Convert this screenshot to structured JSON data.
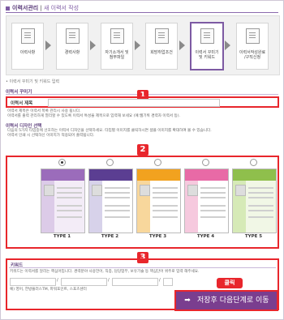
{
  "header": {
    "title": "이력서관리",
    "separator": " | ",
    "subtitle": "새 이력서 작성"
  },
  "steps": [
    {
      "label": "이력사항"
    },
    {
      "label": "경력사항"
    },
    {
      "label": "자기소개서 및\n첨부파일"
    },
    {
      "label": "희망취업조건"
    },
    {
      "label": "이력서 꾸미기\n및 키워드"
    },
    {
      "label": "이력서작성완료\n/구직신청"
    }
  ],
  "page_note": "• 이력서 꾸미기 및 키워드 입력",
  "resume_title_section": {
    "heading": "이력서 꾸미기",
    "field_label": "이력서 제목",
    "badge": "1"
  },
  "design_section": {
    "heading": "이력서 디자인 선택",
    "desc1": "이력서 제목은 이력서 목록 관리시 사용 됩니다.",
    "desc2": "이력서를 출력 관리하게 열리할 수 있도록 이력서 특성을 제목으로 입력해 보세요 (예:웹기획 경력자 이력서 등).",
    "desc3": "다음의 5가지 타입중에 선호하는 이력서 디자인을 선택하세요. 타입별 이미지를 클릭하시면 샘플 이미지를 확대하여 볼 수 있습니다.",
    "desc4": "이력서 인쇄 시 선택하신 이미지가 적용되어 출력됩니다.",
    "badge": "2",
    "types": [
      {
        "label": "TYPE 1",
        "selected": true,
        "accent": "#8a5aa8"
      },
      {
        "label": "TYPE 2",
        "selected": false,
        "accent": "#5b3e92"
      },
      {
        "label": "TYPE 3",
        "selected": false,
        "accent": "#f2a21f"
      },
      {
        "label": "TYPE 4",
        "selected": false,
        "accent": "#e86aa6"
      },
      {
        "label": "TYPE 5",
        "selected": false,
        "accent": "#8fbf4c"
      }
    ]
  },
  "keyword_section": {
    "heading": "키워드",
    "badge": "3",
    "desc": "키워드는 이력서를 알리는 핵심어입니다. 경력분야 사용언어, 직종, 담당업무, 보유기술 등 핵심단어 위주로 입력 해주세요.",
    "example": "예) 영어, 한방플러스TM, 파워포인트, 스포츠센터"
  },
  "click_label": "클릭",
  "save_button": {
    "label": "저장후 다음단계로 이동",
    "arrow": "➡"
  }
}
